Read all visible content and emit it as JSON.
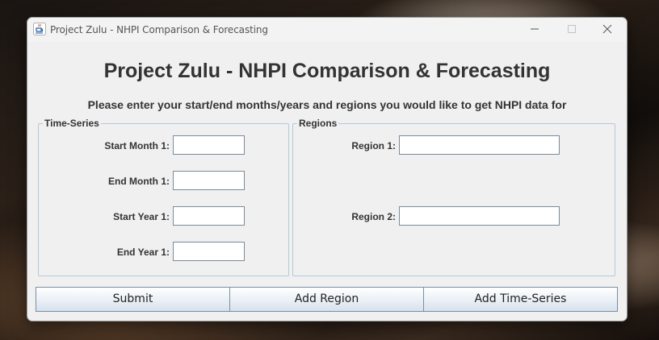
{
  "window": {
    "title": "Project Zulu - NHPI Comparison & Forecasting",
    "icon": "java-icon"
  },
  "main": {
    "heading": "Project Zulu - NHPI Comparison & Forecasting",
    "subheading": "Please enter your start/end months/years and regions you would like to get NHPI data for"
  },
  "time_series": {
    "legend": "Time-Series",
    "start_month_label": "Start Month 1:",
    "end_month_label": "End Month 1:",
    "start_year_label": "Start Year 1:",
    "end_year_label": "End Year 1:",
    "start_month_value": "",
    "end_month_value": "",
    "start_year_value": "",
    "end_year_value": ""
  },
  "regions": {
    "legend": "Regions",
    "region1_label": "Region 1:",
    "region2_label": "Region 2:",
    "region1_value": "",
    "region2_value": ""
  },
  "buttons": {
    "submit": "Submit",
    "add_region": "Add Region",
    "add_time_series": "Add Time-Series"
  }
}
